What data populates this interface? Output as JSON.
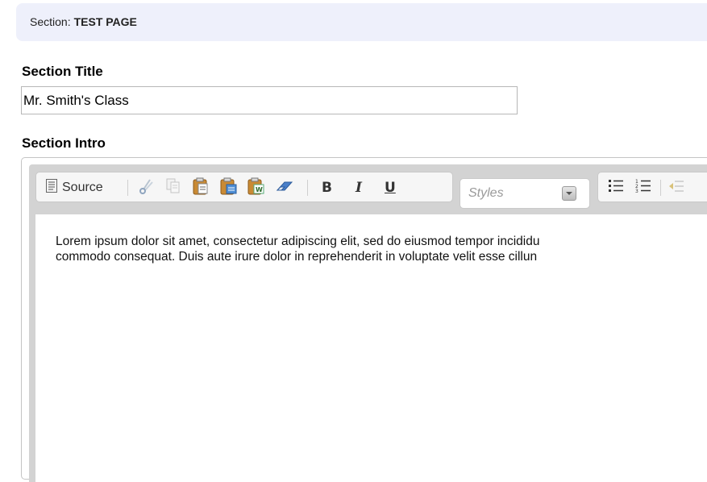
{
  "section_bar": {
    "label": "Section:",
    "value": "TEST PAGE"
  },
  "section_title": {
    "label": "Section Title",
    "value": "Mr. Smith's Class"
  },
  "section_intro": {
    "label": "Section Intro",
    "toolbar": {
      "source_label": "Source",
      "bold_label": "B",
      "italic_label": "I",
      "underline_label": "U",
      "styles_placeholder": "Styles"
    },
    "content_lines": [
      "Lorem ipsum dolor sit amet, consectetur adipiscing elit, sed do eiusmod tempor incididu",
      "commodo consequat. Duis aute irure dolor in reprehenderit in voluptate velit esse cillun"
    ]
  }
}
